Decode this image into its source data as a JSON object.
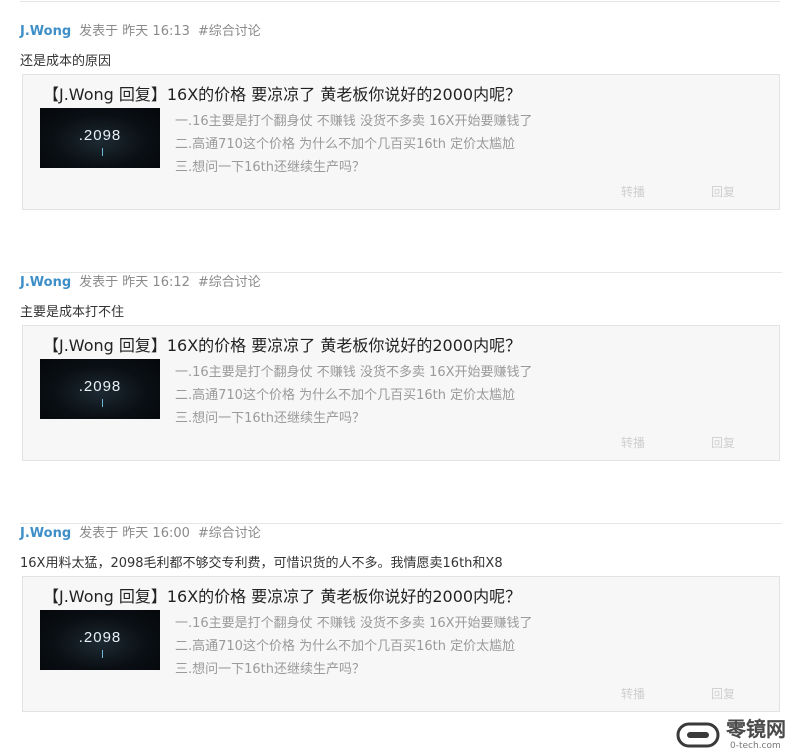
{
  "posts": [
    {
      "author": "J.Wong",
      "meta": "发表于 昨天 16:13",
      "tag": "#综合讨论",
      "text": "还是成本的原因",
      "quote": {
        "title": "【J.Wong 回复】16X的价格 要凉凉了 黄老板你说好的2000内呢？",
        "thumb_text": ".2098",
        "lines": [
          "一.16主要是打个翻身仗 不赚钱 没货不多卖 16X开始要赚钱了",
          "二.高通710这个价格 为什么不加个几百买16th 定价太尴尬",
          "三.想问一下16th还继续生产吗？"
        ],
        "forward_label": "转播",
        "reply_label": "回复"
      }
    },
    {
      "author": "J.Wong",
      "meta": "发表于 昨天 16:12",
      "tag": "#综合讨论",
      "text": "主要是成本打不住",
      "quote": {
        "title": "【J.Wong 回复】16X的价格 要凉凉了 黄老板你说好的2000内呢？",
        "thumb_text": ".2098",
        "lines": [
          "一.16主要是打个翻身仗 不赚钱 没货不多卖 16X开始要赚钱了",
          "二.高通710这个价格 为什么不加个几百买16th 定价太尴尬",
          "三.想问一下16th还继续生产吗？"
        ],
        "forward_label": "转播",
        "reply_label": "回复"
      }
    },
    {
      "author": "J.Wong",
      "meta": "发表于 昨天 16:00",
      "tag": "#综合讨论",
      "text": "16X用料太猛，2098毛利都不够交专利费，可惜识货的人不多。我情愿卖16th和X8",
      "quote": {
        "title": "【J.Wong 回复】16X的价格 要凉凉了 黄老板你说好的2000内呢？",
        "thumb_text": ".2098",
        "lines": [
          "一.16主要是打个翻身仗 不赚钱 没货不多卖 16X开始要赚钱了",
          "二.高通710这个价格 为什么不加个几百买16th 定价太尴尬",
          "三.想问一下16th还继续生产吗？"
        ],
        "forward_label": "转播",
        "reply_label": "回复"
      }
    }
  ],
  "watermark": {
    "name": "零镜网",
    "url": "0-tech.com"
  },
  "colors": {
    "author": "#3e8fc8",
    "meta": "#8a8a8a",
    "quote_bg": "#f7f7f7"
  }
}
